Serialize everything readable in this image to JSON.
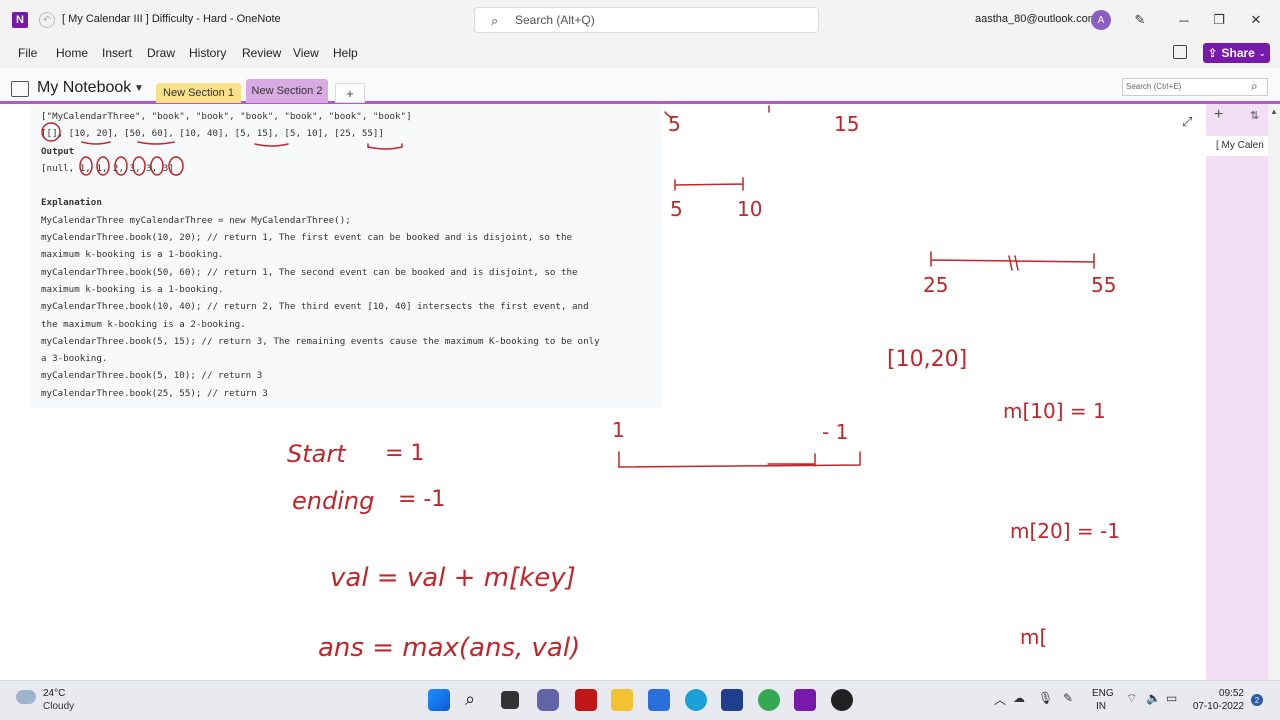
{
  "titlebar": {
    "title": "[ My Calendar III ]  Difficulty - Hard  -  OneNote",
    "search_placeholder": "Search (Alt+Q)",
    "account": "aastha_80@outlook.com",
    "avatar": "A"
  },
  "menu": [
    "File",
    "Home",
    "Insert",
    "Draw",
    "History",
    "Review",
    "View",
    "Help"
  ],
  "share_label": "Share",
  "notebook": {
    "name": "My Notebook",
    "sections": [
      "New Section 1",
      "New Section 2"
    ],
    "search_placeholder": "Search (Ctrl+E)"
  },
  "code_lines": [
    "[\"MyCalendarThree\", \"book\", \"book\", \"book\", \"book\", \"book\", \"book\"]",
    "[[], [10, 20], [50, 60], [10, 40], [5, 15], [5, 10], [25, 55]]",
    "Output",
    "[null, 1, 1, 2, 3, 3, 3]",
    "",
    "Explanation",
    "MyCalendarThree myCalendarThree = new MyCalendarThree();",
    "myCalendarThree.book(10, 20); // return 1, The first event can be booked and is disjoint, so the",
    "maximum k-booking is a 1-booking.",
    "myCalendarThree.book(50, 60); // return 1, The second event can be booked and is disjoint, so the",
    "maximum k-booking is a 1-booking.",
    "myCalendarThree.book(10, 40); // return 2, The third event [10, 40] intersects the first event, and",
    "the maximum k-booking is a 2-booking.",
    "myCalendarThree.book(5, 15); // return 3, The remaining events cause the maximum K-booking to be only",
    "a 3-booking.",
    "myCalendarThree.book(5, 10); // return 3",
    "myCalendarThree.book(25, 55); // return 3"
  ],
  "ink": {
    "n5a": "5",
    "n15": "15",
    "n5b": "5",
    "n10": "10",
    "n25": "25",
    "n55": "55",
    "i1020": "[10,20]",
    "m10": "m[10]  =  1",
    "start": "Start",
    "eq1": "=  1",
    "ending": "ending",
    "eqm1": "= -1",
    "one": "1",
    "mone": "- 1",
    "m20": "m[20]  =  -1",
    "val": "val = val  +  m[key]",
    "ans": "ans  =   max(ans, val)",
    "mtail": "m["
  },
  "page_list": [
    "[ My Calen"
  ],
  "taskbar": {
    "temp": "24°C",
    "condition": "Cloudy",
    "lang1": "ENG",
    "lang2": "IN",
    "time": "09:52",
    "date": "07-10-2022",
    "notifications": "2"
  },
  "colors": {
    "accent": "#7719aa",
    "ink": "#c0262b"
  }
}
